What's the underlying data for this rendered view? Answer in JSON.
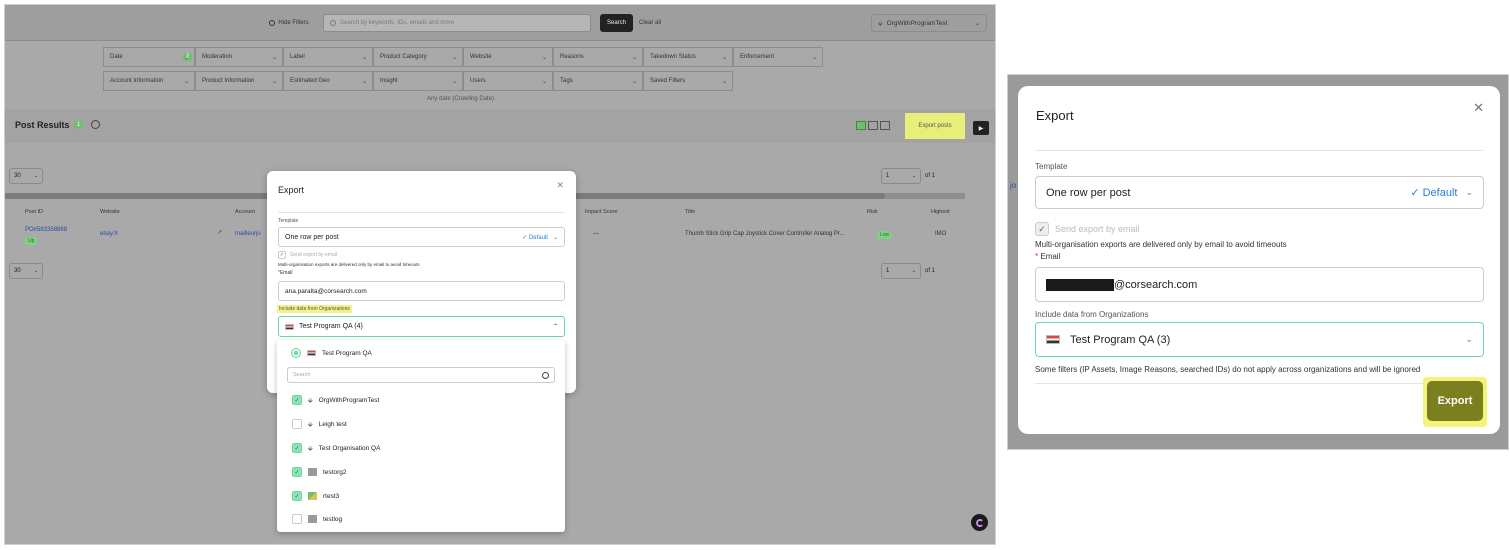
{
  "left": {
    "topbar": {
      "hide_filters": "Hide Filters",
      "search_placeholder": "Search by keywords, IDs, emails and more",
      "search_button": "Search",
      "clear_all": "Clear all",
      "org_select": "OrgWithProgramTest"
    },
    "filters_row1": [
      "Date",
      "Moderation",
      "Label",
      "Product Category",
      "Website",
      "Reasons",
      "Takedown Status",
      "Enforcement"
    ],
    "filters_row2": [
      "Account Information",
      "Product Information",
      "Estimated Geo",
      "Insight",
      "Users",
      "Tags",
      "Saved Filters"
    ],
    "date_badge": "2",
    "date_note": "Any date (Crawling Date)",
    "results": {
      "title": "Post Results",
      "count": "1",
      "export_posts": "Export posts"
    },
    "page_size": "30",
    "pager": {
      "page": "1",
      "of": "of 1"
    },
    "table_headers": [
      "Post ID",
      "Website",
      "Account",
      "Impact Score",
      "Title",
      "Risk",
      "Highest"
    ],
    "row": {
      "post_id": "PO#583358868",
      "status_chip": "Up",
      "website": "ebay.fr",
      "account": "mailleurjo",
      "impact": "—",
      "title": "Thumb Stick Grip Cap Joystick Cover Controller Analog Pr...",
      "risk": "Low",
      "highest": "IMO"
    },
    "modal": {
      "title": "Export",
      "template_label": "Template",
      "template_value": "One row per post",
      "template_default": "✓ Default",
      "send_by_email": "Send export by email",
      "multi_org_note": "Multi-organisation exports are delivered only by email to avoid timeouts",
      "email_label": "Email",
      "email_value": "ana.paralta@corsearch.com",
      "include_label": "Include data from Organizations",
      "org_selected": "Test Program QA (4)"
    },
    "dropdown": {
      "head": "Test Program QA",
      "search_placeholder": "Search",
      "items": [
        {
          "label": "OrgWithProgramTest",
          "checked": true
        },
        {
          "label": "Leigh test",
          "checked": false
        },
        {
          "label": "Test Organisation QA",
          "checked": true
        },
        {
          "label": "testorg2",
          "checked": true
        },
        {
          "label": "rtest3",
          "checked": true
        },
        {
          "label": "testlog",
          "checked": false
        }
      ]
    }
  },
  "right": {
    "edge_text": "jo",
    "modal": {
      "title": "Export",
      "template_label": "Template",
      "template_value": "One row per post",
      "template_default": "✓ Default",
      "send_by_email": "Send export by email",
      "multi_org_note": "Multi-organisation exports are delivered only by email to avoid timeouts",
      "email_label": "Email",
      "email_suffix": "@corsearch.com",
      "include_label": "Include data from Organizations",
      "org_selected": "Test Program QA (3)",
      "warning": "Some filters (IP Assets, Image Reasons, searched IDs) do not apply across organizations and will be ignored",
      "export_button": "Export"
    }
  },
  "icons": {
    "close": "close-icon",
    "chevron": "chevron-down-icon",
    "search": "search-icon",
    "flag": "flag-icon"
  },
  "colors": {
    "accent_green": "#6fd7a3",
    "export_button": "#7b7f1f",
    "highlight": "#f4f47a",
    "default_blue": "#2a7fd4"
  }
}
